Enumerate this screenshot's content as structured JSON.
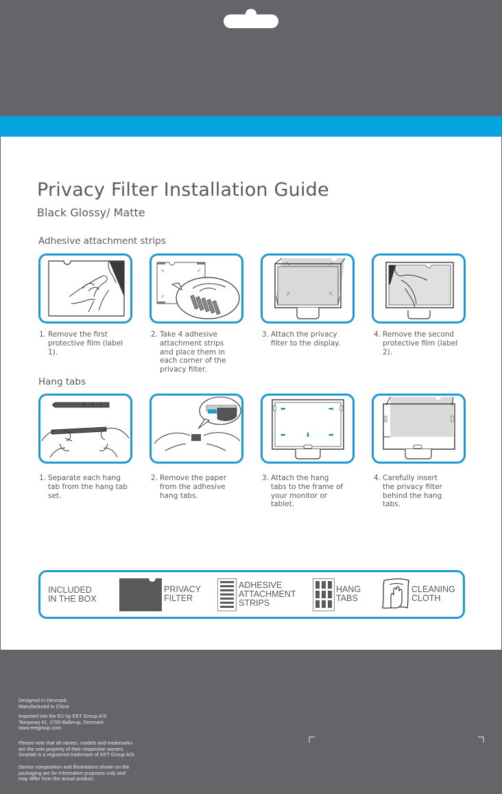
{
  "header": {
    "title": "Privacy Filter Installation Guide",
    "subtitle": "Black Glossy/ Matte"
  },
  "colors": {
    "grey_band": "#646569",
    "accent_blue": "#06a3e0",
    "card_border": "#1b9ad3",
    "text": "#58595b"
  },
  "sections": [
    {
      "heading": "Adhesive attachment strips",
      "steps": [
        {
          "num": "1.",
          "text": "Remove the first protective film (label 1).",
          "illustration": "peel-film-icon"
        },
        {
          "num": "2.",
          "text": "Take 4 adhesive attachment strips and place them in each corner of the privacy filter.",
          "illustration": "adhesive-strips-icon"
        },
        {
          "num": "3.",
          "text": "Attach the privacy filter to the display.",
          "illustration": "attach-filter-monitor-icon"
        },
        {
          "num": "4.",
          "text": "Remove the second protective film (label 2).",
          "illustration": "peel-second-film-icon"
        }
      ]
    },
    {
      "heading": "Hang tabs",
      "steps": [
        {
          "num": "1.",
          "text": "Separate each hang tab from the hang tab set.",
          "illustration": "separate-hang-tabs-icon"
        },
        {
          "num": "2.",
          "text": "Remove the paper from the adhesive hang tabs.",
          "illustration": "remove-paper-icon"
        },
        {
          "num": "3.",
          "text": "Attach the hang tabs to the frame of your monitor or tablet.",
          "illustration": "attach-hang-tabs-icon"
        },
        {
          "num": "4.",
          "text": "Carefully insert the privacy filter behind the hang tabs.",
          "illustration": "insert-filter-icon"
        }
      ]
    }
  ],
  "included_box": {
    "heading": "INCLUDED\nIN THE BOX",
    "items": [
      {
        "label": "PRIVACY\nFILTER",
        "icon": "privacy-filter-icon"
      },
      {
        "label": "ADHESIVE\nATTACHMENT\nSTRIPS",
        "icon": "adhesive-strips-icon"
      },
      {
        "label": "HANG\nTABS",
        "icon": "hang-tabs-icon"
      },
      {
        "label": "CLEANING\nCLOTH",
        "icon": "cleaning-cloth-icon"
      }
    ]
  },
  "footer": {
    "origin": "Designed in Denmark\nManufactured in China",
    "importer": "Imported into the EU by EET Group A/S\nTempovej 41, 2750 Ballerup, Denmark\nwww.eetgroup.com",
    "trademark": "Please note that all names, models and trademarks\nare the sole property of their respective owners.\nGearlab is a registered trademark of EET Group A/S.",
    "disclaimer": "Device composition and illustrations shown on the\npackaging are for informative purposes only and\nmay differ from the actual product."
  }
}
